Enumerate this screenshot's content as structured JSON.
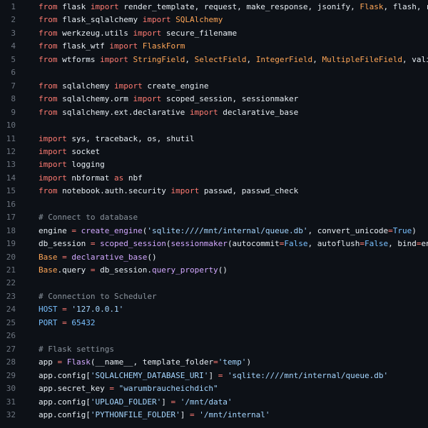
{
  "colors": {
    "background": "#0d1117",
    "line_number": "#6e7681",
    "keyword": "#ff7b72",
    "name": "#e6edf3",
    "comment": "#8b949e",
    "string": "#a5d6ff",
    "function": "#d2a8ff",
    "class_name": "#ffa657",
    "constant": "#79c0ff"
  },
  "lines": [
    {
      "num": "1",
      "tokens": [
        {
          "t": "from",
          "c": "k"
        },
        {
          "t": " flask ",
          "c": "n"
        },
        {
          "t": "import",
          "c": "k"
        },
        {
          "t": " render_template, request, make_response, jsonify, ",
          "c": "n"
        },
        {
          "t": "Flask",
          "c": "v"
        },
        {
          "t": ", flash, redirect",
          "c": "n"
        }
      ]
    },
    {
      "num": "2",
      "tokens": [
        {
          "t": "from",
          "c": "k"
        },
        {
          "t": " flask_sqlalchemy ",
          "c": "n"
        },
        {
          "t": "import",
          "c": "k"
        },
        {
          "t": " ",
          "c": "n"
        },
        {
          "t": "SQLAlchemy",
          "c": "v"
        }
      ]
    },
    {
      "num": "3",
      "tokens": [
        {
          "t": "from",
          "c": "k"
        },
        {
          "t": " werkzeug.utils ",
          "c": "n"
        },
        {
          "t": "import",
          "c": "k"
        },
        {
          "t": " secure_filename",
          "c": "n"
        }
      ]
    },
    {
      "num": "4",
      "tokens": [
        {
          "t": "from",
          "c": "k"
        },
        {
          "t": " flask_wtf ",
          "c": "n"
        },
        {
          "t": "import",
          "c": "k"
        },
        {
          "t": " ",
          "c": "n"
        },
        {
          "t": "FlaskForm",
          "c": "v"
        }
      ]
    },
    {
      "num": "5",
      "tokens": [
        {
          "t": "from",
          "c": "k"
        },
        {
          "t": " wtforms ",
          "c": "n"
        },
        {
          "t": "import",
          "c": "k"
        },
        {
          "t": " ",
          "c": "n"
        },
        {
          "t": "StringField",
          "c": "v"
        },
        {
          "t": ", ",
          "c": "n"
        },
        {
          "t": "SelectField",
          "c": "v"
        },
        {
          "t": ", ",
          "c": "n"
        },
        {
          "t": "IntegerField",
          "c": "v"
        },
        {
          "t": ", ",
          "c": "n"
        },
        {
          "t": "MultipleFileField",
          "c": "v"
        },
        {
          "t": ", validators",
          "c": "n"
        }
      ]
    },
    {
      "num": "6",
      "tokens": []
    },
    {
      "num": "7",
      "tokens": [
        {
          "t": "from",
          "c": "k"
        },
        {
          "t": " sqlalchemy ",
          "c": "n"
        },
        {
          "t": "import",
          "c": "k"
        },
        {
          "t": " create_engine",
          "c": "n"
        }
      ]
    },
    {
      "num": "8",
      "tokens": [
        {
          "t": "from",
          "c": "k"
        },
        {
          "t": " sqlalchemy.orm ",
          "c": "n"
        },
        {
          "t": "import",
          "c": "k"
        },
        {
          "t": " scoped_session, sessionmaker",
          "c": "n"
        }
      ]
    },
    {
      "num": "9",
      "tokens": [
        {
          "t": "from",
          "c": "k"
        },
        {
          "t": " sqlalchemy.ext.declarative ",
          "c": "n"
        },
        {
          "t": "import",
          "c": "k"
        },
        {
          "t": " declarative_base",
          "c": "n"
        }
      ]
    },
    {
      "num": "10",
      "tokens": []
    },
    {
      "num": "11",
      "tokens": [
        {
          "t": "import",
          "c": "k"
        },
        {
          "t": " sys, traceback, os, shutil",
          "c": "n"
        }
      ]
    },
    {
      "num": "12",
      "tokens": [
        {
          "t": "import",
          "c": "k"
        },
        {
          "t": " socket",
          "c": "n"
        }
      ]
    },
    {
      "num": "13",
      "tokens": [
        {
          "t": "import",
          "c": "k"
        },
        {
          "t": " logging",
          "c": "n"
        }
      ]
    },
    {
      "num": "14",
      "tokens": [
        {
          "t": "import",
          "c": "k"
        },
        {
          "t": " nbformat ",
          "c": "n"
        },
        {
          "t": "as",
          "c": "k"
        },
        {
          "t": " nbf",
          "c": "n"
        }
      ]
    },
    {
      "num": "15",
      "tokens": [
        {
          "t": "from",
          "c": "k"
        },
        {
          "t": " notebook.auth.security ",
          "c": "n"
        },
        {
          "t": "import",
          "c": "k"
        },
        {
          "t": " passwd, passwd_check",
          "c": "n"
        }
      ]
    },
    {
      "num": "16",
      "tokens": []
    },
    {
      "num": "17",
      "tokens": [
        {
          "t": "# Connect to database",
          "c": "c"
        }
      ]
    },
    {
      "num": "18",
      "tokens": [
        {
          "t": "engine ",
          "c": "n"
        },
        {
          "t": "=",
          "c": "k"
        },
        {
          "t": " ",
          "c": "n"
        },
        {
          "t": "create_engine",
          "c": "f"
        },
        {
          "t": "(",
          "c": "n"
        },
        {
          "t": "'sqlite:////mnt/internal/queue.db'",
          "c": "s"
        },
        {
          "t": ", convert_unicode",
          "c": "n"
        },
        {
          "t": "=",
          "c": "k"
        },
        {
          "t": "True",
          "c": "b"
        },
        {
          "t": ")",
          "c": "n"
        }
      ]
    },
    {
      "num": "19",
      "tokens": [
        {
          "t": "db_session ",
          "c": "n"
        },
        {
          "t": "=",
          "c": "k"
        },
        {
          "t": " ",
          "c": "n"
        },
        {
          "t": "scoped_session",
          "c": "f"
        },
        {
          "t": "(",
          "c": "n"
        },
        {
          "t": "sessionmaker",
          "c": "f"
        },
        {
          "t": "(autocommit",
          "c": "n"
        },
        {
          "t": "=",
          "c": "k"
        },
        {
          "t": "False",
          "c": "b"
        },
        {
          "t": ", autoflush",
          "c": "n"
        },
        {
          "t": "=",
          "c": "k"
        },
        {
          "t": "False",
          "c": "b"
        },
        {
          "t": ", bind",
          "c": "n"
        },
        {
          "t": "=",
          "c": "k"
        },
        {
          "t": "engine))",
          "c": "n"
        }
      ]
    },
    {
      "num": "20",
      "tokens": [
        {
          "t": "Base",
          "c": "v"
        },
        {
          "t": " ",
          "c": "n"
        },
        {
          "t": "=",
          "c": "k"
        },
        {
          "t": " ",
          "c": "n"
        },
        {
          "t": "declarative_base",
          "c": "f"
        },
        {
          "t": "()",
          "c": "n"
        }
      ]
    },
    {
      "num": "21",
      "tokens": [
        {
          "t": "Base",
          "c": "v"
        },
        {
          "t": ".query ",
          "c": "n"
        },
        {
          "t": "=",
          "c": "k"
        },
        {
          "t": " db_session.",
          "c": "n"
        },
        {
          "t": "query_property",
          "c": "f"
        },
        {
          "t": "()",
          "c": "n"
        }
      ]
    },
    {
      "num": "22",
      "tokens": []
    },
    {
      "num": "23",
      "tokens": [
        {
          "t": "# Connection to Scheduler",
          "c": "c"
        }
      ]
    },
    {
      "num": "24",
      "tokens": [
        {
          "t": "HOST",
          "c": "b"
        },
        {
          "t": " ",
          "c": "n"
        },
        {
          "t": "=",
          "c": "k"
        },
        {
          "t": " ",
          "c": "n"
        },
        {
          "t": "'127.0.0.1'",
          "c": "s"
        }
      ]
    },
    {
      "num": "25",
      "tokens": [
        {
          "t": "PORT",
          "c": "b"
        },
        {
          "t": " ",
          "c": "n"
        },
        {
          "t": "=",
          "c": "k"
        },
        {
          "t": " ",
          "c": "n"
        },
        {
          "t": "65432",
          "c": "b"
        }
      ]
    },
    {
      "num": "26",
      "tokens": []
    },
    {
      "num": "27",
      "tokens": [
        {
          "t": "# Flask settings",
          "c": "c"
        }
      ]
    },
    {
      "num": "28",
      "tokens": [
        {
          "t": "app ",
          "c": "n"
        },
        {
          "t": "=",
          "c": "k"
        },
        {
          "t": " ",
          "c": "n"
        },
        {
          "t": "Flask",
          "c": "f"
        },
        {
          "t": "(__name__, template_folder",
          "c": "n"
        },
        {
          "t": "=",
          "c": "k"
        },
        {
          "t": "'temp'",
          "c": "s"
        },
        {
          "t": ")",
          "c": "n"
        }
      ]
    },
    {
      "num": "29",
      "tokens": [
        {
          "t": "app.config[",
          "c": "n"
        },
        {
          "t": "'SQLALCHEMY_DATABASE_URI'",
          "c": "s"
        },
        {
          "t": "] ",
          "c": "n"
        },
        {
          "t": "=",
          "c": "k"
        },
        {
          "t": " ",
          "c": "n"
        },
        {
          "t": "'sqlite:////mnt/internal/queue.db'",
          "c": "s"
        }
      ]
    },
    {
      "num": "30",
      "tokens": [
        {
          "t": "app.secret_key ",
          "c": "n"
        },
        {
          "t": "=",
          "c": "k"
        },
        {
          "t": " ",
          "c": "n"
        },
        {
          "t": "\"warumbraucheichdich\"",
          "c": "s"
        }
      ]
    },
    {
      "num": "31",
      "tokens": [
        {
          "t": "app.config[",
          "c": "n"
        },
        {
          "t": "'UPLOAD_FOLDER'",
          "c": "s"
        },
        {
          "t": "] ",
          "c": "n"
        },
        {
          "t": "=",
          "c": "k"
        },
        {
          "t": " ",
          "c": "n"
        },
        {
          "t": "'/mnt/data'",
          "c": "s"
        }
      ]
    },
    {
      "num": "32",
      "tokens": [
        {
          "t": "app.config[",
          "c": "n"
        },
        {
          "t": "'PYTHONFILE_FOLDER'",
          "c": "s"
        },
        {
          "t": "] ",
          "c": "n"
        },
        {
          "t": "=",
          "c": "k"
        },
        {
          "t": " ",
          "c": "n"
        },
        {
          "t": "'/mnt/internal'",
          "c": "s"
        }
      ]
    }
  ]
}
